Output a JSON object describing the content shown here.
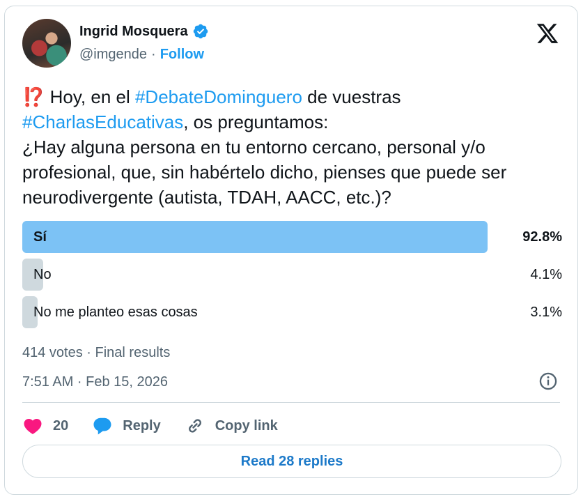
{
  "author": {
    "name": "Ingrid Mosquera",
    "handle": "@imgende",
    "separator": "·",
    "follow_label": "Follow"
  },
  "tweet": {
    "emoji": "⁉️",
    "line1_pre": " Hoy, en el ",
    "hashtag1": "#DebateDominguero",
    "line1_post": " de vuestras",
    "hashtag2": "#CharlasEducativas",
    "line2_post": ", os preguntamos:",
    "body": "¿Hay alguna persona en tu entorno cercano, personal y/o profesional, que, sin habértelo dicho, pienses que puede ser neurodivergente (autista, TDAH, AACC, etc.)?"
  },
  "poll": {
    "options": [
      {
        "label": "Sí",
        "percent_label": "92.8%",
        "percent": 92.8,
        "winner": true
      },
      {
        "label": "No",
        "percent_label": "4.1%",
        "percent": 4.1,
        "winner": false
      },
      {
        "label": "No me planteo esas cosas",
        "percent_label": "3.1%",
        "percent": 3.1,
        "winner": false
      }
    ],
    "summary": "414 votes · Final results"
  },
  "timestamp": "7:51 AM · Feb 15, 2026",
  "actions": {
    "likes": "20",
    "reply_label": "Reply",
    "copy_label": "Copy link"
  },
  "read_replies_label": "Read 28 replies",
  "colors": {
    "accent": "#1d9bf0",
    "winner_bar": "#7cc2f5",
    "loser_bar": "#cfd9de",
    "like": "#f91880"
  },
  "icons": [
    "verified-badge-icon",
    "x-logo-icon",
    "info-icon",
    "heart-icon",
    "reply-bubble-icon",
    "link-icon"
  ]
}
